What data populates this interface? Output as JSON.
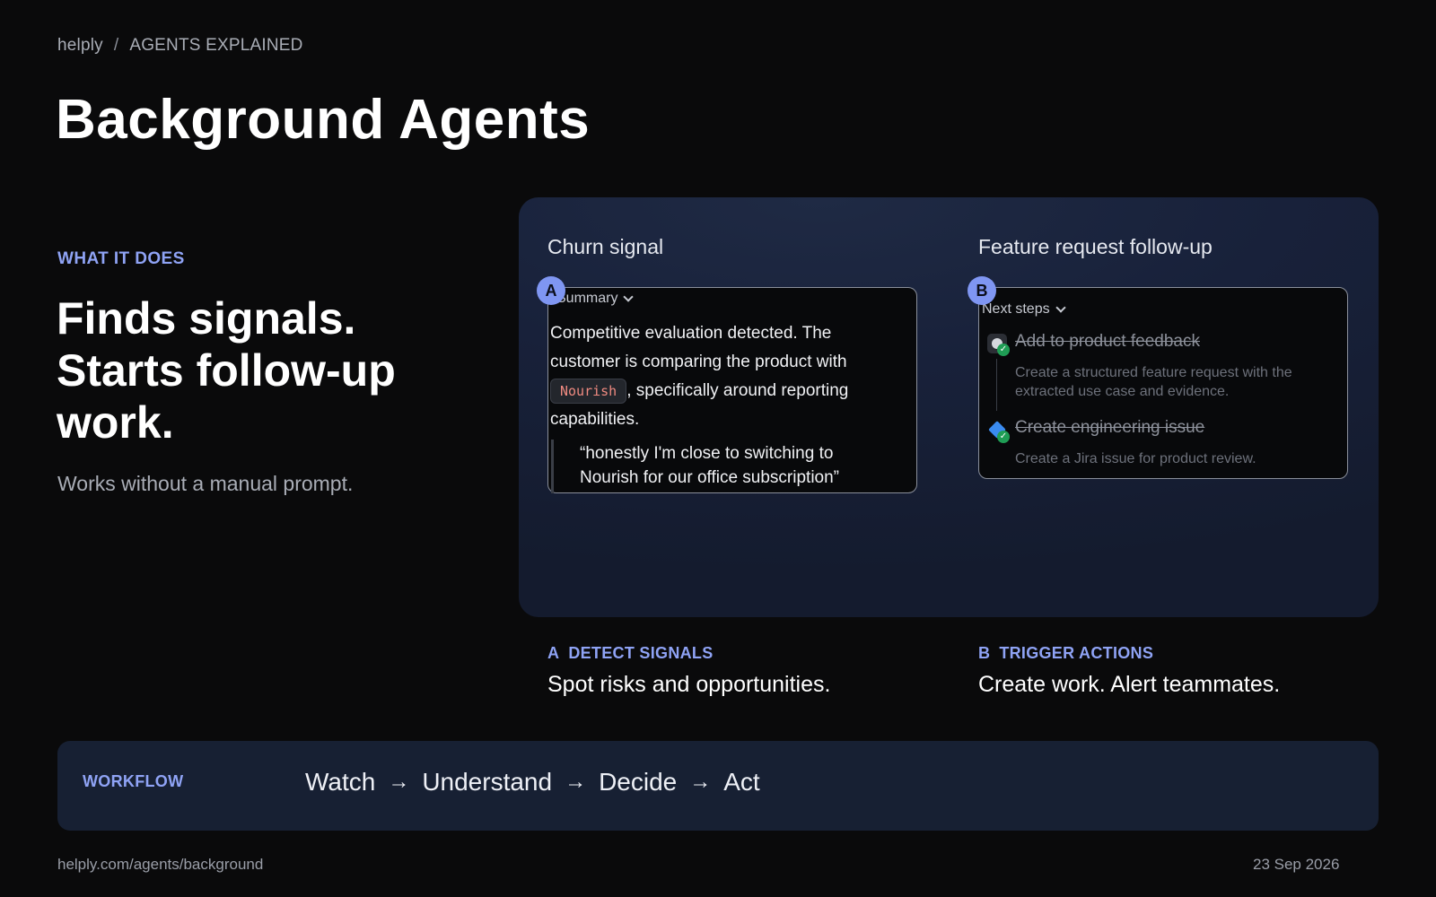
{
  "breadcrumb": {
    "brand": "helply",
    "separator": "/",
    "section": "AGENTS EXPLAINED"
  },
  "page_title": "Background Agents",
  "intro": {
    "eyebrow": "WHAT IT DOES",
    "headline": "Finds signals. Starts follow-up work.",
    "subline": "Works without a manual prompt."
  },
  "card_a": {
    "title": "Churn signal",
    "badge": "A",
    "dropdown_label": "Summary",
    "summary_before": "Competitive evaluation detected. The customer is comparing the product with ",
    "competitor_chip": "Nourish",
    "summary_after": ", specifically around reporting capabilities.",
    "quote": "“honestly I'm close to switching to Nourish for our office subscription”"
  },
  "card_b": {
    "title": "Feature request follow-up",
    "badge": "B",
    "dropdown_label": "Next steps",
    "steps": [
      {
        "title": "Add to product feedback",
        "description": "Create a structured feature request with the extracted use case and evidence.",
        "icon": "feedback-icon",
        "status": "done"
      },
      {
        "title": "Create engineering issue",
        "description": "Create a Jira issue for product review.",
        "icon": "jira-icon",
        "status": "done"
      }
    ]
  },
  "captions": {
    "a": {
      "letter": "A",
      "label": "DETECT SIGNALS",
      "text": "Spot risks and opportunities."
    },
    "b": {
      "letter": "B",
      "label": "TRIGGER ACTIONS",
      "text": "Create work. Alert teammates."
    }
  },
  "workflow": {
    "label": "WORKFLOW",
    "steps": [
      "Watch",
      "Understand",
      "Decide",
      "Act"
    ],
    "arrow": "→"
  },
  "footer": {
    "url": "helply.com/agents/background",
    "date": "23 Sep 2026"
  },
  "colors": {
    "accent": "#8fa3f5",
    "badge": "#7f96f2",
    "panel": "#18213a",
    "workflow_bg": "#172033",
    "chip_text": "#ef8a80",
    "check": "#1f9d55"
  }
}
